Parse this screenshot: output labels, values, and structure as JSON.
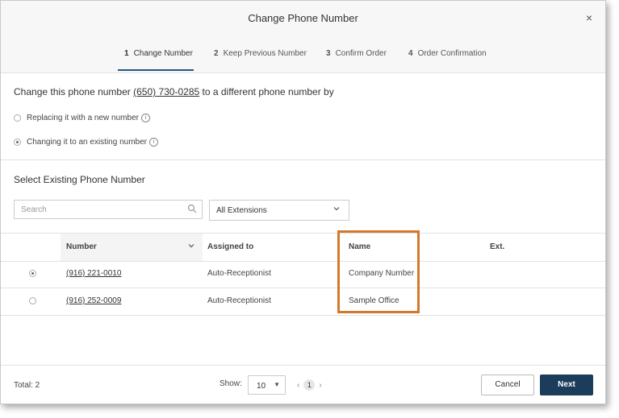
{
  "dialog": {
    "title": "Change Phone Number",
    "close_glyph": "×"
  },
  "steps": [
    {
      "num": "1",
      "label": "Change Number",
      "active": true
    },
    {
      "num": "2",
      "label": "Keep Previous Number",
      "active": false
    },
    {
      "num": "3",
      "label": "Confirm Order",
      "active": false
    },
    {
      "num": "4",
      "label": "Order Confirmation",
      "active": false
    }
  ],
  "change": {
    "lead_before": "Change this phone number ",
    "phone": "(650) 730-0285",
    "lead_after": " to a different phone number by",
    "options": [
      {
        "label": "Replacing it with a new number",
        "checked": false
      },
      {
        "label": "Changing it to an existing number",
        "checked": true
      }
    ]
  },
  "existing": {
    "title": "Select Existing Phone Number",
    "search_placeholder": "Search",
    "filter_value": "All Extensions"
  },
  "table": {
    "columns": [
      "Number",
      "Assigned to",
      "Name",
      "Ext."
    ],
    "rows": [
      {
        "selected": true,
        "number": "(916) 221-0010",
        "assigned": "Auto-Receptionist",
        "name": "Company Number",
        "ext": ""
      },
      {
        "selected": false,
        "number": "(916) 252-0009",
        "assigned": "Auto-Receptionist",
        "name": "Sample Office",
        "ext": ""
      }
    ]
  },
  "footer": {
    "total": "Total: 2",
    "show_label": "Show:",
    "page_size": "10",
    "current_page": "1",
    "cancel": "Cancel",
    "next": "Next"
  },
  "colors": {
    "primary": "#1b3c5a",
    "highlight": "#d2792b",
    "active_step": "#1f5a83"
  }
}
